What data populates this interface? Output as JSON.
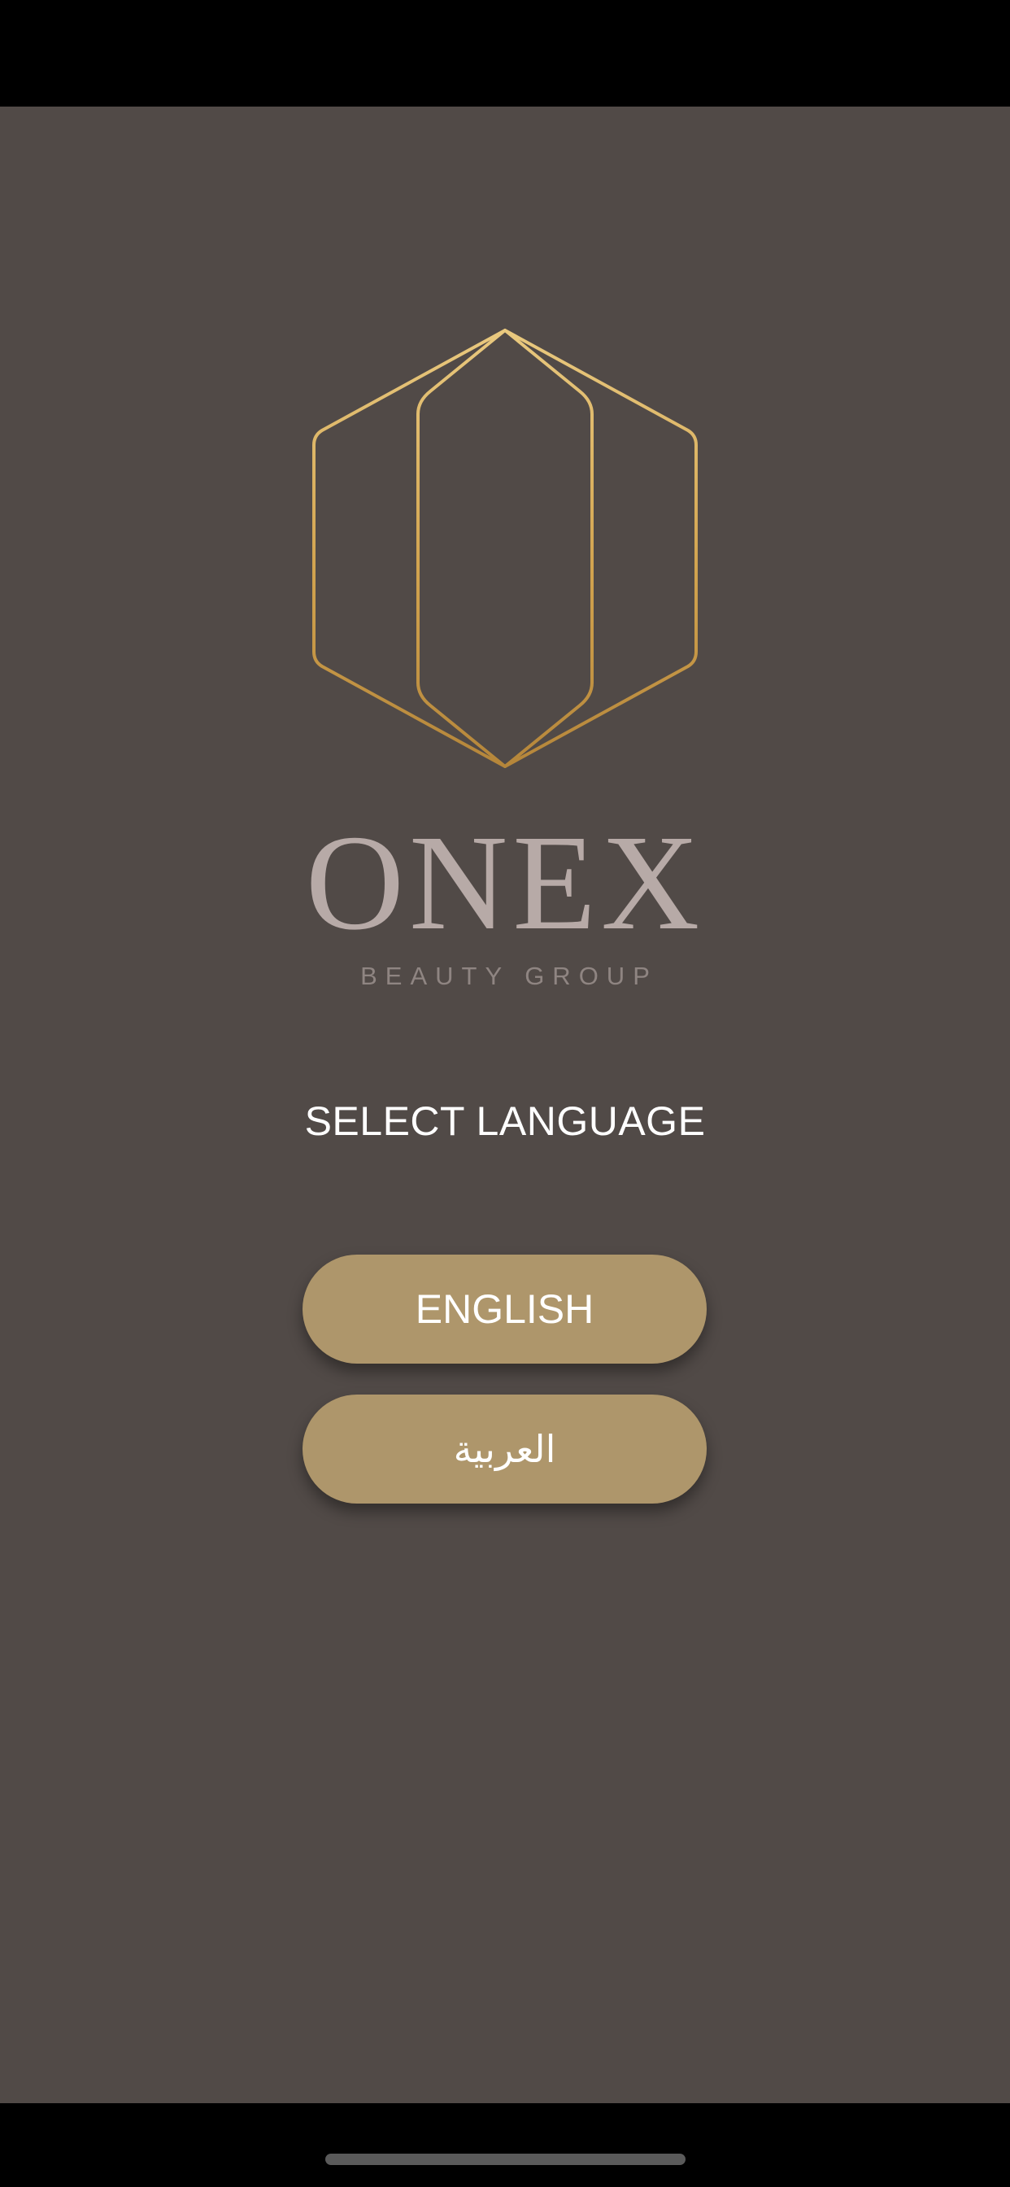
{
  "brand": {
    "name": "ONEX",
    "subtitle": "BEAUTY GROUP",
    "logo_icon": "hexagon-lines-logo-icon"
  },
  "language_select": {
    "heading": "SELECT LANGUAGE",
    "options": [
      {
        "label": "ENGLISH"
      },
      {
        "label": "العربية"
      }
    ]
  },
  "colors": {
    "background": "#514a47",
    "button": "#ae966b",
    "logo_gold_light": "#e6c47a",
    "logo_gold_dark": "#b5863a",
    "brand_text": "#b7aaa7"
  }
}
